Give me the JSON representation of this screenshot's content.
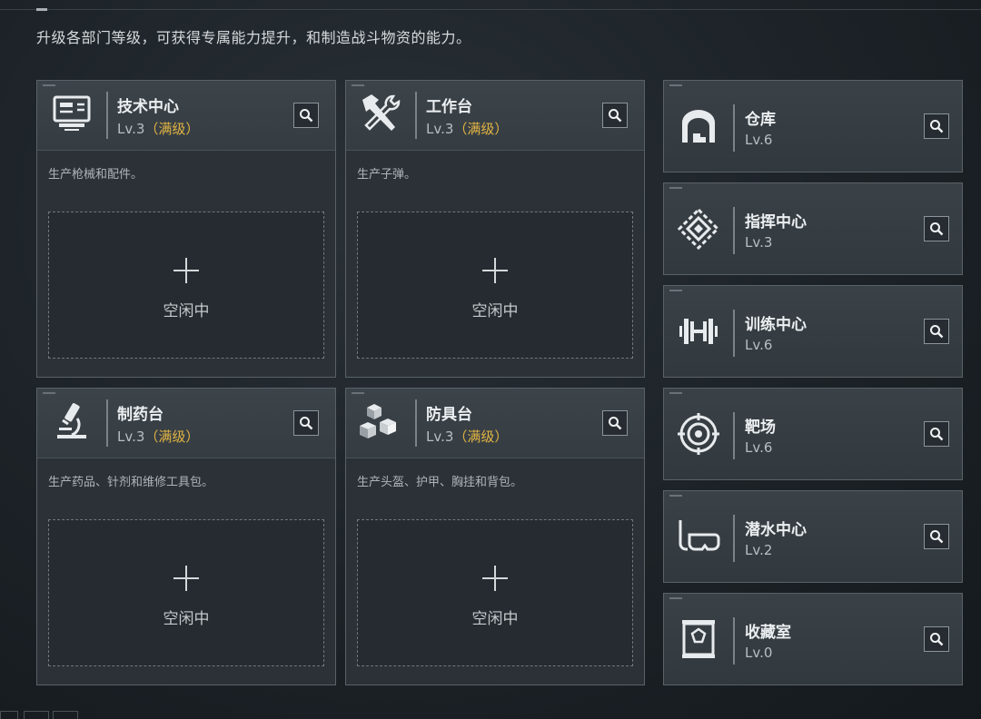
{
  "subtitle": "升级各部门等级，可获得专属能力提升，和制造战斗物资的能力。",
  "workshops": [
    {
      "name": "技术中心",
      "level": "Lv.3",
      "max": "（满级）",
      "desc": "生产枪械和配件。",
      "slot": "空闲中",
      "icon": "computer-icon"
    },
    {
      "name": "工作台",
      "level": "Lv.3",
      "max": "（满级）",
      "desc": "生产子弹。",
      "slot": "空闲中",
      "icon": "hammer-wrench-icon"
    },
    {
      "name": "制药台",
      "level": "Lv.3",
      "max": "（满级）",
      "desc": "生产药品、针剂和维修工具包。",
      "slot": "空闲中",
      "icon": "microscope-icon"
    },
    {
      "name": "防具台",
      "level": "Lv.3",
      "max": "（满级）",
      "desc": "生产头盔、护甲、胸挂和背包。",
      "slot": "空闲中",
      "icon": "cubes-icon"
    }
  ],
  "facilities": [
    {
      "name": "仓库",
      "level": "Lv.6",
      "icon": "warehouse-icon"
    },
    {
      "name": "指挥中心",
      "level": "Lv.3",
      "icon": "command-emblem-icon"
    },
    {
      "name": "训练中心",
      "level": "Lv.6",
      "icon": "dumbbell-icon"
    },
    {
      "name": "靶场",
      "level": "Lv.6",
      "icon": "target-icon"
    },
    {
      "name": "潜水中心",
      "level": "Lv.2",
      "icon": "snorkel-mask-icon"
    },
    {
      "name": "收藏室",
      "level": "Lv.0",
      "icon": "display-case-icon"
    }
  ],
  "colors": {
    "accent_max": "#e2b443",
    "panel": "#2b3136",
    "border": "#5a6268"
  }
}
